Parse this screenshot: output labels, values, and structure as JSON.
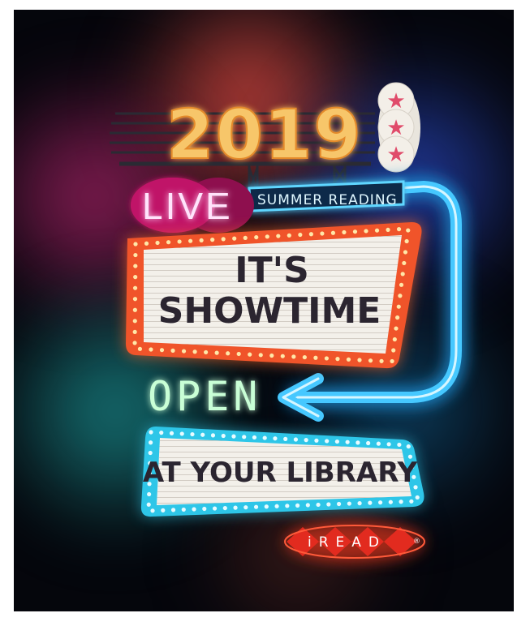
{
  "poster": {
    "year": "2019",
    "live_sign": "LIVE",
    "summer_sign": "SUMMER READING",
    "marquee_line1": "IT'S",
    "marquee_line2": "SHOWTIME",
    "open_sign": "OPEN",
    "library_sign": "AT YOUR LIBRARY",
    "logo": "iREAD",
    "logo_mark": "®",
    "star_count": 3
  },
  "colors": {
    "year_bulbs": "#f7c66a",
    "marquee_frame": "#ff6a2a",
    "marquee_panel": "#f3f0ea",
    "neon_blue": "#46c8ff",
    "neon_pink": "#ff4fd0",
    "neon_green": "#b6ffc8",
    "library_frame": "#2ec6e8",
    "logo_red": "#e22b1f"
  }
}
